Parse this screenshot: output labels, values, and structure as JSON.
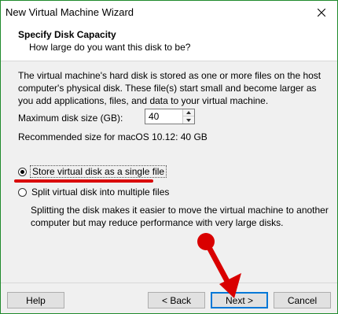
{
  "window": {
    "title": "New Virtual Machine Wizard"
  },
  "header": {
    "title": "Specify Disk Capacity",
    "subtitle": "How large do you want this disk to be?"
  },
  "main": {
    "description": "The virtual machine's hard disk is stored as one or more files on the host computer's physical disk. These file(s) start small and become larger as you add applications, files, and data to your virtual machine.",
    "max_disk_label": "Maximum disk size (GB):",
    "max_disk_value": "40",
    "recommended": "Recommended size for macOS 10.12: 40 GB",
    "options": [
      {
        "label": "Store virtual disk as a single file",
        "selected": true
      },
      {
        "label": "Split virtual disk into multiple files",
        "selected": false
      }
    ],
    "split_description": "Splitting the disk makes it easier to move the virtual machine to another computer but may reduce performance with very large disks."
  },
  "buttons": {
    "help": "Help",
    "back": "< Back",
    "next": "Next >",
    "cancel": "Cancel"
  },
  "colors": {
    "annotation": "#d90000",
    "window_border": "#1f8a2c",
    "default_button_border": "#0078d7"
  }
}
